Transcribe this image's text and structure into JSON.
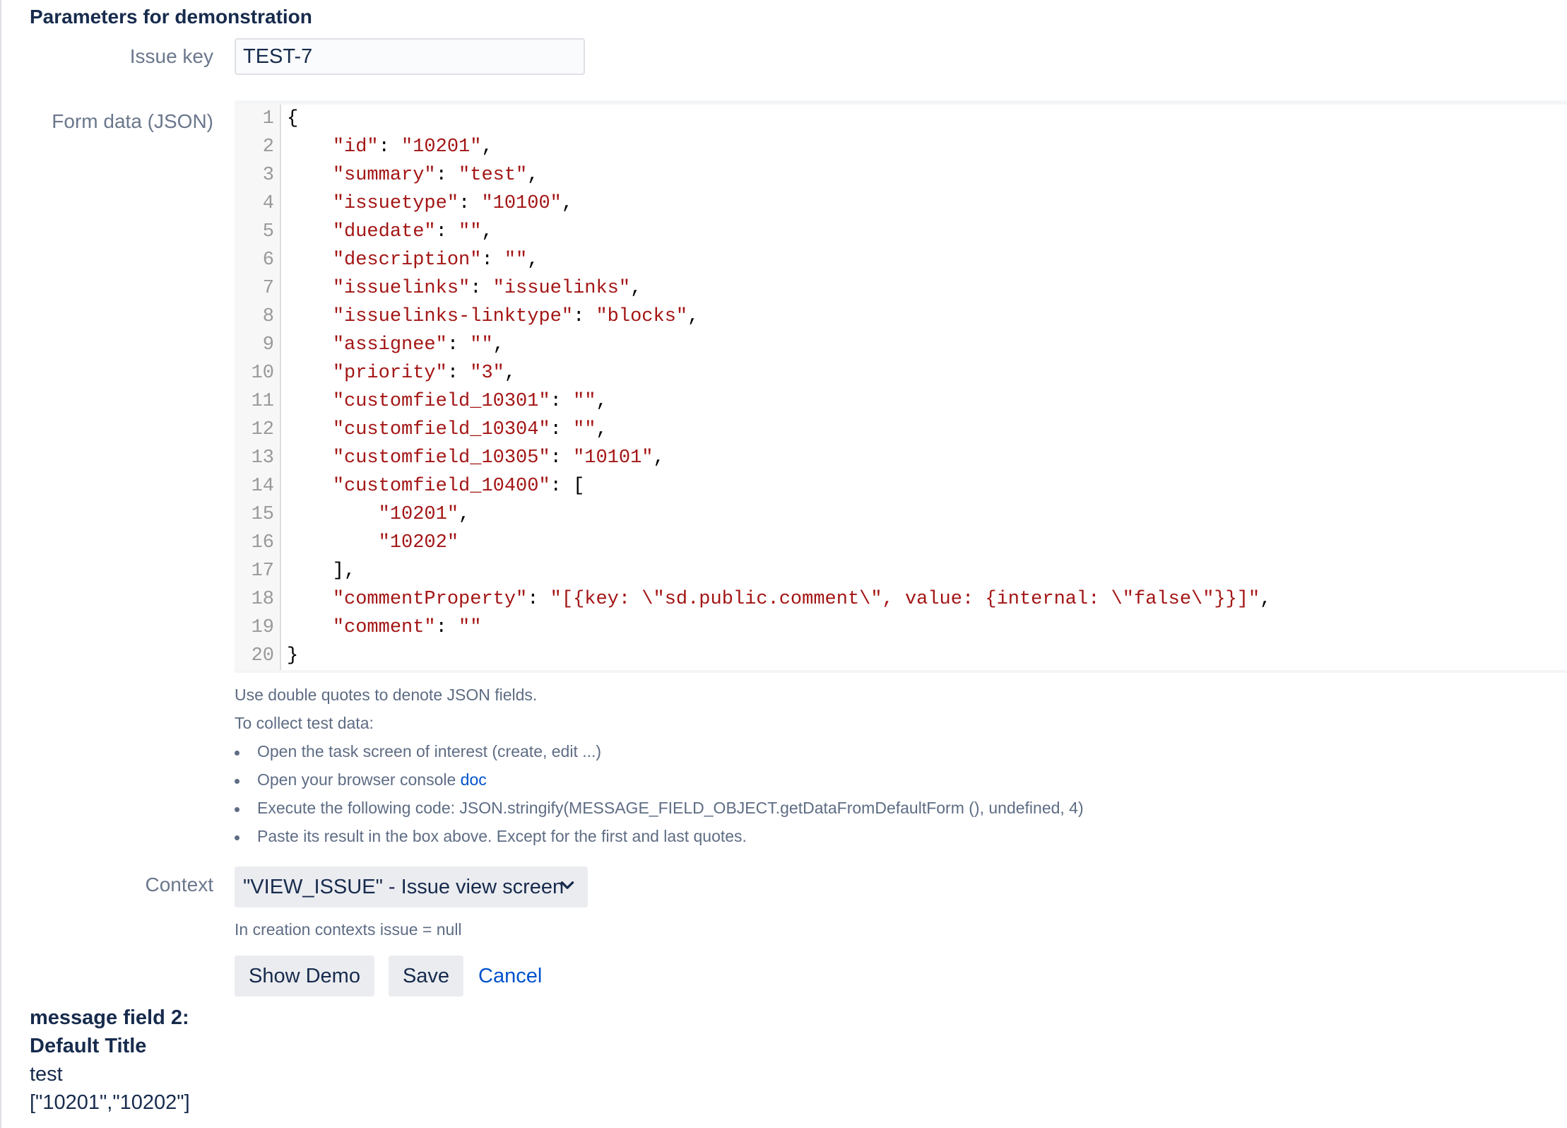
{
  "section_title": "Parameters for demonstration",
  "issue_key": {
    "label": "Issue key",
    "value": "TEST-7"
  },
  "form_data": {
    "label": "Form data (JSON)",
    "lines": [
      {
        "num": "1",
        "parts": [
          {
            "t": "{",
            "c": "punct"
          }
        ]
      },
      {
        "num": "2",
        "parts": [
          {
            "t": "    ",
            "c": "punct"
          },
          {
            "t": "\"id\"",
            "c": "key"
          },
          {
            "t": ": ",
            "c": "punct"
          },
          {
            "t": "\"10201\"",
            "c": "str"
          },
          {
            "t": ",",
            "c": "punct"
          }
        ]
      },
      {
        "num": "3",
        "parts": [
          {
            "t": "    ",
            "c": "punct"
          },
          {
            "t": "\"summary\"",
            "c": "key"
          },
          {
            "t": ": ",
            "c": "punct"
          },
          {
            "t": "\"test\"",
            "c": "str"
          },
          {
            "t": ",",
            "c": "punct"
          }
        ]
      },
      {
        "num": "4",
        "parts": [
          {
            "t": "    ",
            "c": "punct"
          },
          {
            "t": "\"issuetype\"",
            "c": "key"
          },
          {
            "t": ": ",
            "c": "punct"
          },
          {
            "t": "\"10100\"",
            "c": "str"
          },
          {
            "t": ",",
            "c": "punct"
          }
        ]
      },
      {
        "num": "5",
        "parts": [
          {
            "t": "    ",
            "c": "punct"
          },
          {
            "t": "\"duedate\"",
            "c": "key"
          },
          {
            "t": ": ",
            "c": "punct"
          },
          {
            "t": "\"\"",
            "c": "str"
          },
          {
            "t": ",",
            "c": "punct"
          }
        ]
      },
      {
        "num": "6",
        "parts": [
          {
            "t": "    ",
            "c": "punct"
          },
          {
            "t": "\"description\"",
            "c": "key"
          },
          {
            "t": ": ",
            "c": "punct"
          },
          {
            "t": "\"\"",
            "c": "str"
          },
          {
            "t": ",",
            "c": "punct"
          }
        ]
      },
      {
        "num": "7",
        "parts": [
          {
            "t": "    ",
            "c": "punct"
          },
          {
            "t": "\"issuelinks\"",
            "c": "key"
          },
          {
            "t": ": ",
            "c": "punct"
          },
          {
            "t": "\"issuelinks\"",
            "c": "str"
          },
          {
            "t": ",",
            "c": "punct"
          }
        ]
      },
      {
        "num": "8",
        "parts": [
          {
            "t": "    ",
            "c": "punct"
          },
          {
            "t": "\"issuelinks-linktype\"",
            "c": "key"
          },
          {
            "t": ": ",
            "c": "punct"
          },
          {
            "t": "\"blocks\"",
            "c": "str"
          },
          {
            "t": ",",
            "c": "punct"
          }
        ]
      },
      {
        "num": "9",
        "parts": [
          {
            "t": "    ",
            "c": "punct"
          },
          {
            "t": "\"assignee\"",
            "c": "key"
          },
          {
            "t": ": ",
            "c": "punct"
          },
          {
            "t": "\"\"",
            "c": "str"
          },
          {
            "t": ",",
            "c": "punct"
          }
        ]
      },
      {
        "num": "10",
        "parts": [
          {
            "t": "    ",
            "c": "punct"
          },
          {
            "t": "\"priority\"",
            "c": "key"
          },
          {
            "t": ": ",
            "c": "punct"
          },
          {
            "t": "\"3\"",
            "c": "str"
          },
          {
            "t": ",",
            "c": "punct"
          }
        ]
      },
      {
        "num": "11",
        "parts": [
          {
            "t": "    ",
            "c": "punct"
          },
          {
            "t": "\"customfield_10301\"",
            "c": "key"
          },
          {
            "t": ": ",
            "c": "punct"
          },
          {
            "t": "\"\"",
            "c": "str"
          },
          {
            "t": ",",
            "c": "punct"
          }
        ]
      },
      {
        "num": "12",
        "parts": [
          {
            "t": "    ",
            "c": "punct"
          },
          {
            "t": "\"customfield_10304\"",
            "c": "key"
          },
          {
            "t": ": ",
            "c": "punct"
          },
          {
            "t": "\"\"",
            "c": "str"
          },
          {
            "t": ",",
            "c": "punct"
          }
        ]
      },
      {
        "num": "13",
        "parts": [
          {
            "t": "    ",
            "c": "punct"
          },
          {
            "t": "\"customfield_10305\"",
            "c": "key"
          },
          {
            "t": ": ",
            "c": "punct"
          },
          {
            "t": "\"10101\"",
            "c": "str"
          },
          {
            "t": ",",
            "c": "punct"
          }
        ]
      },
      {
        "num": "14",
        "parts": [
          {
            "t": "    ",
            "c": "punct"
          },
          {
            "t": "\"customfield_10400\"",
            "c": "key"
          },
          {
            "t": ": [",
            "c": "punct"
          }
        ]
      },
      {
        "num": "15",
        "parts": [
          {
            "t": "        ",
            "c": "punct"
          },
          {
            "t": "\"10201\"",
            "c": "str"
          },
          {
            "t": ",",
            "c": "punct"
          }
        ]
      },
      {
        "num": "16",
        "parts": [
          {
            "t": "        ",
            "c": "punct"
          },
          {
            "t": "\"10202\"",
            "c": "str"
          }
        ]
      },
      {
        "num": "17",
        "parts": [
          {
            "t": "    ],",
            "c": "punct"
          }
        ]
      },
      {
        "num": "18",
        "parts": [
          {
            "t": "    ",
            "c": "punct"
          },
          {
            "t": "\"commentProperty\"",
            "c": "key"
          },
          {
            "t": ": ",
            "c": "punct"
          },
          {
            "t": "\"[{key: \\\"sd.public.comment\\\", value: {internal: \\\"false\\\"}}]\"",
            "c": "str"
          },
          {
            "t": ",",
            "c": "punct"
          }
        ]
      },
      {
        "num": "19",
        "parts": [
          {
            "t": "    ",
            "c": "punct"
          },
          {
            "t": "\"comment\"",
            "c": "key"
          },
          {
            "t": ": ",
            "c": "punct"
          },
          {
            "t": "\"\"",
            "c": "str"
          }
        ]
      },
      {
        "num": "20",
        "parts": [
          {
            "t": "}",
            "c": "punct"
          }
        ]
      }
    ],
    "colors": {
      "key": "#a31515",
      "str": "#a31515",
      "punct": "#000000"
    }
  },
  "help": {
    "line1": "Use double quotes to denote JSON fields.",
    "line2": "To collect test data:",
    "bullets": [
      "Open the task screen of interest (create, edit ...)",
      "Open your browser console ",
      "Execute the following code: JSON.stringify(MESSAGE_FIELD_OBJECT.getDataFromDefaultForm (), undefined, 4)",
      "Paste its result in the box above. Except for the first and last quotes."
    ],
    "doc_link": "doc"
  },
  "context": {
    "label": "Context",
    "selected": "\"VIEW_ISSUE\" - Issue view screen",
    "chevron_icon": "chevron-down-icon",
    "note": "In creation contexts issue = null"
  },
  "buttons": {
    "show_demo": "Show Demo",
    "save": "Save",
    "cancel": "Cancel"
  },
  "result": {
    "title_line1": "message field 2:",
    "title_line2": "Default Title",
    "value1": "test",
    "value2": "[\"10201\",\"10202\"]"
  }
}
